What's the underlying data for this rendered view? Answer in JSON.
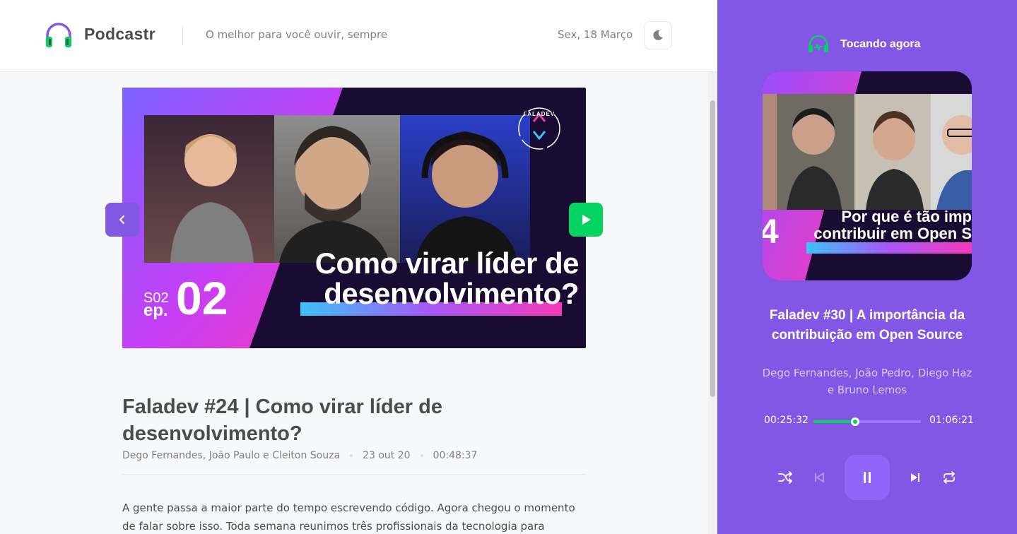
{
  "header": {
    "brand": "Podcastr",
    "tagline": "O melhor para você ouvir, sempre",
    "date": "Sex, 18 Março"
  },
  "episode": {
    "thumbnail": {
      "season": "S02",
      "ep_prefix": "ep.",
      "ep_number": "02",
      "headline_line1": "Como virar líder de",
      "headline_line2": "desenvolvimento?",
      "badge_text": "FALADEV"
    },
    "title": "Faladev #24 | Como virar líder de desenvolvimento?",
    "members": "Dego Fernandes, João Paulo e Cleiton Souza",
    "published": "23 out 20",
    "duration": "00:48:37",
    "description": "A gente passa a maior parte do tempo escrevendo código. Agora chegou o momento de falar sobre isso. Toda semana reunimos três profissionais da tecnologia para"
  },
  "player": {
    "heading": "Tocando agora",
    "cover_caption_line1": "Por que é tão imp",
    "cover_caption_line2": "contribuir em Open S",
    "cover_number": "4",
    "title": "Faladev #30 | A importância da contribuição em Open Source",
    "members": "Dego Fernandes, João Pedro, Diego Haz e Bruno Lemos",
    "current_time": "00:25:32",
    "total_time": "01:06:21",
    "progress": 0.385
  },
  "colors": {
    "primary": "#8257e5",
    "green": "#04d361",
    "text": "#494d4b",
    "muted": "#808080"
  }
}
